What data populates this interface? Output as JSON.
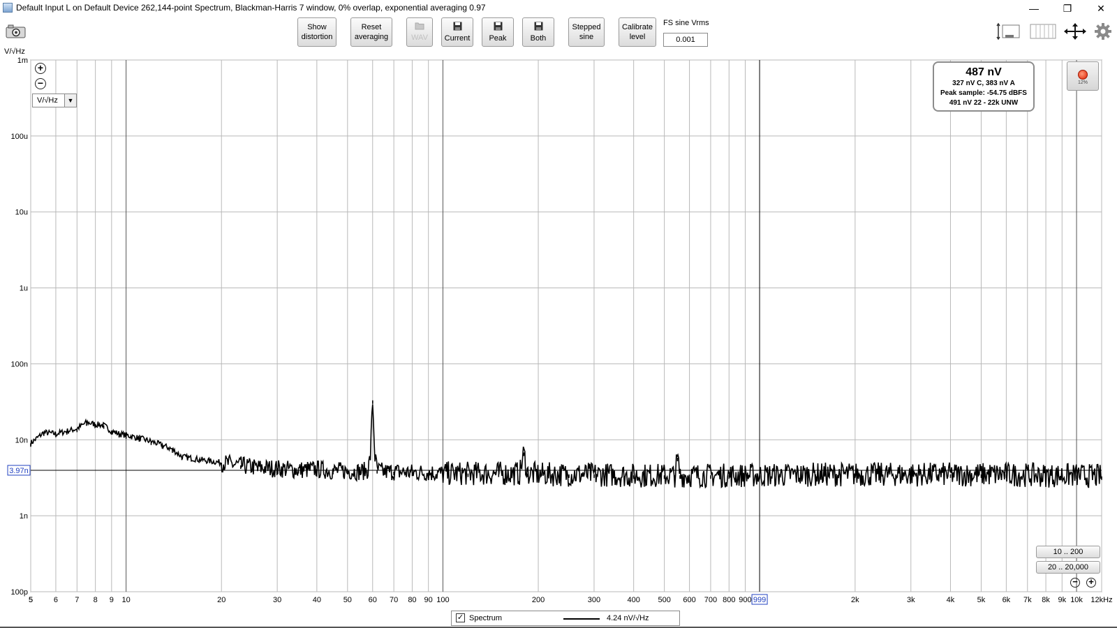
{
  "window": {
    "title": "Default Input L on Default Device 262,144-point Spectrum, Blackman-Harris 7 window, 0% overlap, exponential averaging 0.97",
    "minimize": "—",
    "restore": "❐",
    "close": "✕"
  },
  "toolbar": {
    "show_distortion": "Show\ndistortion",
    "reset_averaging": "Reset\naveraging",
    "wav": "WAV",
    "current": "Current",
    "peak": "Peak",
    "both": "Both",
    "stepped_sine": "Stepped\nsine",
    "calibrate_level": "Calibrate\nlevel",
    "fs_sine_label": "FS sine Vrms",
    "fs_sine_value": "0.001"
  },
  "icons": {
    "camera": "camera-icon",
    "save": "save-icon",
    "folder": "folder-icon",
    "settings": "gear-icon",
    "fit": "move-arrows-icon"
  },
  "plot": {
    "y_unit_label": "V/√Hz",
    "unit_select_value": "V/√Hz",
    "cursor_value": "3.97n",
    "cursor_freq": "999",
    "zoom_in": "+",
    "zoom_out": "−"
  },
  "readout": {
    "main": "487 nV",
    "line1": "327 nV C, 383 nV A",
    "line2": "Peak sample: -54.75 dBFS",
    "line3": "491 nV 22 - 22k UNW"
  },
  "record": {
    "percent": "12%"
  },
  "ranges": {
    "r1": "10 .. 200",
    "r2": "20 .. 20,000"
  },
  "legend": {
    "checked": "✓",
    "name": "Spectrum",
    "value": "4.24 nV/√Hz"
  },
  "chart_data": {
    "type": "line",
    "title": "",
    "xlabel": "",
    "ylabel": "V/√Hz",
    "x_scale": "log",
    "y_scale": "log",
    "xlim": [
      5,
      12000
    ],
    "ylim": [
      1e-10,
      0.001
    ],
    "grid": true,
    "legend_position": "bottom-center",
    "x_ticks": [
      5,
      6,
      7,
      8,
      9,
      10,
      20,
      30,
      40,
      50,
      60,
      70,
      80,
      90,
      100,
      200,
      300,
      400,
      500,
      600,
      700,
      800,
      900,
      2000,
      3000,
      4000,
      5000,
      6000,
      7000,
      8000,
      9000,
      10000,
      12000
    ],
    "x_tick_labels": [
      "5",
      "6",
      "7",
      "8",
      "9",
      "10",
      "20",
      "30",
      "40",
      "50",
      "60",
      "70",
      "80",
      "90",
      "100",
      "200",
      "300",
      "400",
      "500",
      "600",
      "700",
      "800",
      "900",
      "2k",
      "3k",
      "4k",
      "5k",
      "6k",
      "7k",
      "8k",
      "9k",
      "10k",
      "12kHz"
    ],
    "first_tick_label": "5",
    "y_ticks": [
      1e-10,
      1e-09,
      1e-08,
      1e-07,
      1e-06,
      1e-05,
      0.0001,
      0.001
    ],
    "y_tick_labels": [
      "100p",
      "1n",
      "10n",
      "100n",
      "1u",
      "10u",
      "100u",
      "1m"
    ],
    "cursor": {
      "x": 999,
      "y": 3.97e-09
    },
    "series": [
      {
        "name": "Spectrum",
        "color": "#000000",
        "x": [
          5,
          5.5,
          6,
          6.5,
          7,
          7.5,
          8,
          8.5,
          9,
          9.5,
          10,
          11,
          12,
          13,
          14,
          15,
          17,
          20,
          23,
          26,
          30,
          35,
          40,
          45,
          50,
          55,
          58,
          59,
          60,
          61,
          62,
          65,
          70,
          80,
          90,
          100,
          120,
          150,
          175,
          180,
          185,
          200,
          250,
          300,
          400,
          500,
          540,
          550,
          560,
          600,
          700,
          800,
          999,
          1500,
          2000,
          3000,
          4000,
          5000,
          6000,
          8000,
          10000,
          12000
        ],
        "values": [
          9e-09,
          1.25e-08,
          1.2e-08,
          1.3e-08,
          1.4e-08,
          1.7e-08,
          1.6e-08,
          1.55e-08,
          1.3e-08,
          1.2e-08,
          1.15e-08,
          1.05e-08,
          9.5e-09,
          8.5e-09,
          7.5e-09,
          6e-09,
          5.5e-09,
          5e-09,
          4.6e-09,
          4.3e-09,
          4.2e-09,
          4e-09,
          4.1e-09,
          3.9e-09,
          3.9e-09,
          3.8e-09,
          4e-09,
          6e-09,
          3.3e-08,
          6e-09,
          4e-09,
          3.8e-09,
          3.8e-09,
          3.7e-09,
          3.7e-09,
          3.6e-09,
          3.6e-09,
          3.6e-09,
          3.6e-09,
          6.8e-09,
          3.6e-09,
          3.5e-09,
          3.5e-09,
          3.5e-09,
          3.4e-09,
          3.4e-09,
          3.4e-09,
          5.8e-09,
          3.4e-09,
          3.4e-09,
          3.4e-09,
          3.4e-09,
          3.4e-09,
          3.5e-09,
          3.5e-09,
          3.5e-09,
          3.5e-09,
          3.5e-09,
          3.5e-09,
          3.4e-09,
          3.4e-09,
          3.3e-09
        ]
      }
    ]
  }
}
